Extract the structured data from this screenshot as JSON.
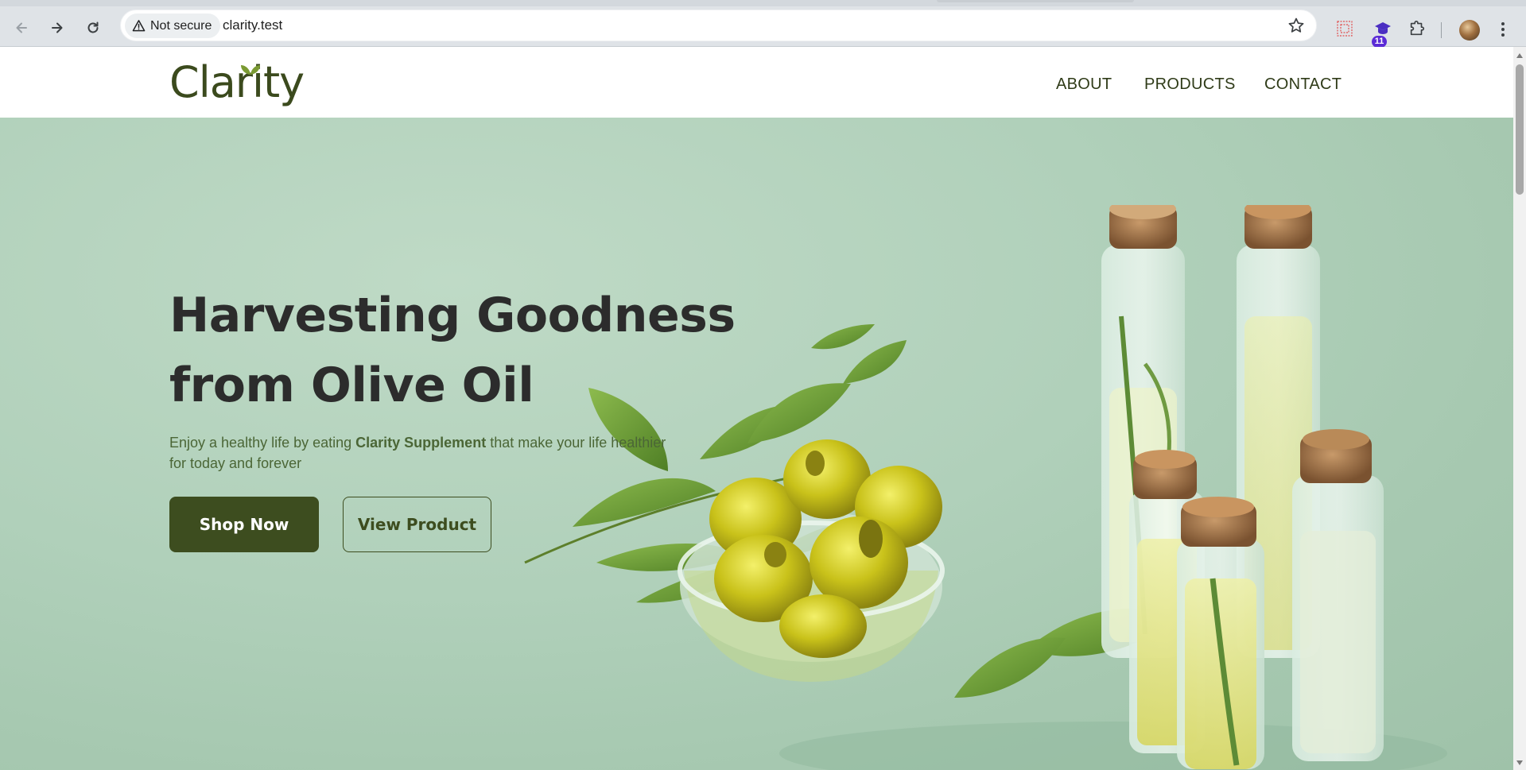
{
  "browser": {
    "security_label": "Not secure",
    "url": "clarity.test",
    "extension_badge": "11",
    "icons": [
      "back-arrow-icon",
      "forward-arrow-icon",
      "reload-icon",
      "warning-triangle-icon",
      "star-icon",
      "extension-grid-icon",
      "extension-cap-icon",
      "puzzle-icon",
      "kebab-menu-icon"
    ]
  },
  "site": {
    "logo": "Clarity",
    "nav": [
      "ABOUT",
      "PRODUCTS",
      "CONTACT"
    ]
  },
  "hero": {
    "headline_line1": "Harvesting Goodness",
    "headline_line2": "from Olive Oil",
    "sub_before": "Enjoy a healthy life by eating ",
    "sub_bold": "Clarity Supplement",
    "sub_after": " that make your life healthier for today and forever",
    "primary_button": "Shop Now",
    "secondary_button": "View Product"
  },
  "colors": {
    "brand_dark": "#3d4d1f",
    "hero_bg": "#b0d0ba",
    "headline": "#2c2c2c",
    "subtext": "#4b6636"
  }
}
